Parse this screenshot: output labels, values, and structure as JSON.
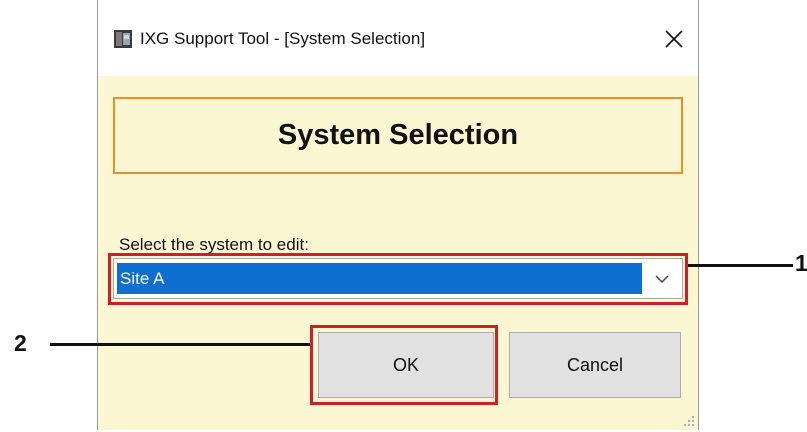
{
  "window": {
    "title": "IXG Support Tool - [System Selection]",
    "icon": "app-icon",
    "close_glyph": "✕"
  },
  "header": {
    "title": "System Selection"
  },
  "system_select": {
    "label": "Select the system to edit:",
    "value": "Site A"
  },
  "buttons": {
    "ok": "OK",
    "cancel": "Cancel"
  },
  "callouts": {
    "combo_number": "1",
    "ok_number": "2",
    "color": "#cc1f2a"
  },
  "colors": {
    "dialog_bg": "#fbf7d3",
    "header_border": "#f08c28",
    "selection_bg": "#0f6fd0"
  }
}
